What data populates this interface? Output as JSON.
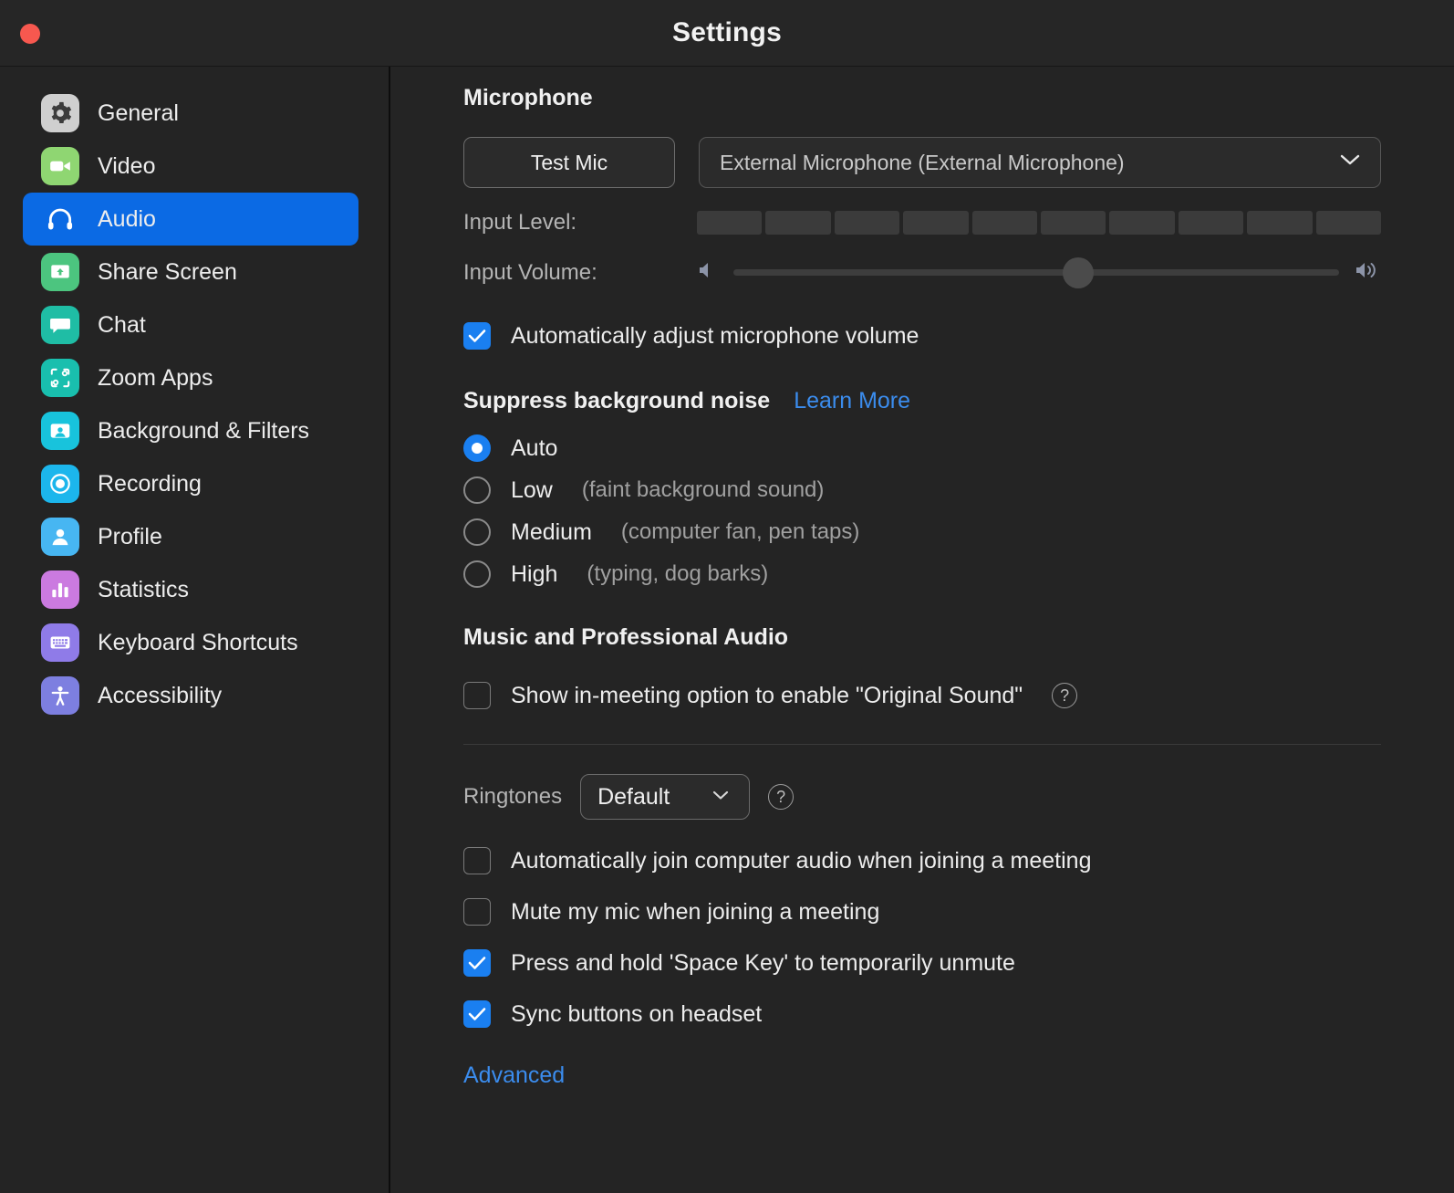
{
  "window": {
    "title": "Settings",
    "close_button": "close"
  },
  "sidebar": {
    "items": [
      {
        "label": "General",
        "icon": "gear-icon",
        "color": "#cfcfcf",
        "selected": false
      },
      {
        "label": "Video",
        "icon": "video-camera-icon",
        "color": "#8fd672",
        "selected": false
      },
      {
        "label": "Audio",
        "icon": "headphones-icon",
        "color": "#0b6ae4",
        "selected": true
      },
      {
        "label": "Share Screen",
        "icon": "share-screen-icon",
        "color": "#4cc57f",
        "selected": false
      },
      {
        "label": "Chat",
        "icon": "chat-bubble-icon",
        "color": "#1fbda5",
        "selected": false
      },
      {
        "label": "Zoom Apps",
        "icon": "zoom-apps-icon",
        "color": "#19bfae",
        "selected": false
      },
      {
        "label": "Background & Filters",
        "icon": "background-filters-icon",
        "color": "#18c3dc",
        "selected": false
      },
      {
        "label": "Recording",
        "icon": "recording-icon",
        "color": "#1cb6ec",
        "selected": false
      },
      {
        "label": "Profile",
        "icon": "profile-icon",
        "color": "#47b6f2",
        "selected": false
      },
      {
        "label": "Statistics",
        "icon": "statistics-icon",
        "color": "#cb7ae0",
        "selected": false
      },
      {
        "label": "Keyboard Shortcuts",
        "icon": "keyboard-icon",
        "color": "#8f7be8",
        "selected": false
      },
      {
        "label": "Accessibility",
        "icon": "accessibility-icon",
        "color": "#7d7fe0",
        "selected": false
      }
    ]
  },
  "audio": {
    "microphone": {
      "heading": "Microphone",
      "test_button": "Test Mic",
      "device_selected": "External Microphone (External Microphone)",
      "dropdown_icon": "chevron-down-icon",
      "input_level_label": "Input Level:",
      "input_level_segments": 10,
      "input_level_lit": 0,
      "input_volume_label": "Input Volume:",
      "input_volume_percent": 57,
      "volume_low_icon": "speaker-low-icon",
      "volume_high_icon": "speaker-high-icon",
      "auto_adjust": {
        "label": "Automatically adjust microphone volume",
        "checked": true
      }
    },
    "suppress_noise": {
      "heading": "Suppress background noise",
      "learn_more": "Learn More",
      "selected": "Auto",
      "options": [
        {
          "label": "Auto",
          "hint": "",
          "checked": true
        },
        {
          "label": "Low",
          "hint": "(faint background sound)",
          "checked": false
        },
        {
          "label": "Medium",
          "hint": "(computer fan, pen taps)",
          "checked": false
        },
        {
          "label": "High",
          "hint": "(typing, dog barks)",
          "checked": false
        }
      ]
    },
    "music_audio": {
      "heading": "Music and Professional Audio",
      "original_sound": {
        "label": "Show in-meeting option to enable \"Original Sound\"",
        "checked": false,
        "help_icon": "question-mark-icon",
        "help_glyph": "?"
      }
    },
    "ringtones": {
      "label": "Ringtones",
      "selected": "Default",
      "dropdown_icon": "chevron-down-icon",
      "help_icon": "question-mark-icon",
      "help_glyph": "?"
    },
    "meeting_options": [
      {
        "label": "Automatically join computer audio when joining a meeting",
        "checked": false
      },
      {
        "label": "Mute my mic when joining a meeting",
        "checked": false
      },
      {
        "label": "Press and hold 'Space Key' to temporarily unmute",
        "checked": true
      },
      {
        "label": "Sync buttons on headset",
        "checked": true
      }
    ],
    "advanced_link": "Advanced"
  }
}
